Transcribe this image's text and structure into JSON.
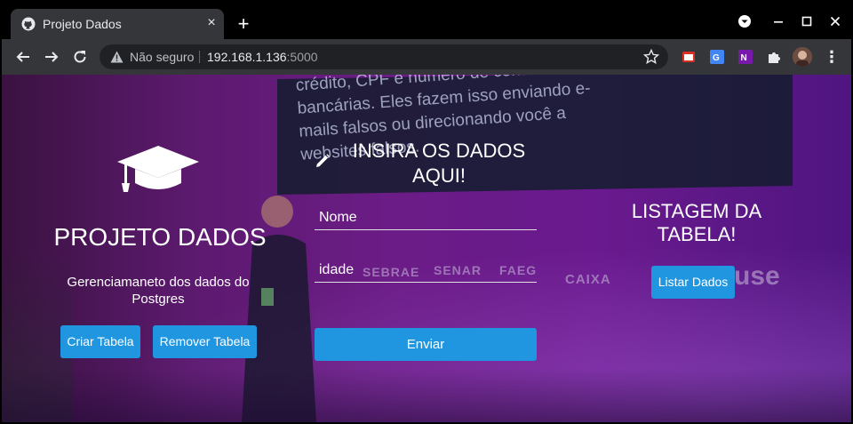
{
  "browser": {
    "tab_title": "Projeto Dados",
    "tab_close": "×",
    "new_tab": "+",
    "security_label": "Não seguro",
    "url_host": "192.168.1.136",
    "url_port": ":5000",
    "menu_glyph": "⋮"
  },
  "background": {
    "screen_text": "crédito, CPF e número de contas bancárias. Eles fazem isso enviando e-mails falsos ou direcionando você a websites falsos.",
    "sponsors": [
      "SEBRAE",
      "SENAR",
      "FAEG",
      "CAIXA",
      "use"
    ]
  },
  "left": {
    "title": "PROJETO DADOS",
    "subtitle": "Gerenciamaneto dos dados do Postgres",
    "criar_label": "Criar Tabela",
    "remover_label": "Remover Tabela"
  },
  "form": {
    "title": "INSIRA OS DADOS AQUI!",
    "nome_placeholder": "Nome",
    "idade_placeholder": "idade",
    "enviar_label": "Enviar"
  },
  "right": {
    "title": "LISTAGEM DA TABELA!",
    "listar_label": "Listar Dados"
  },
  "colors": {
    "button": "#2196e0",
    "background_purple": "#6b1c86"
  }
}
